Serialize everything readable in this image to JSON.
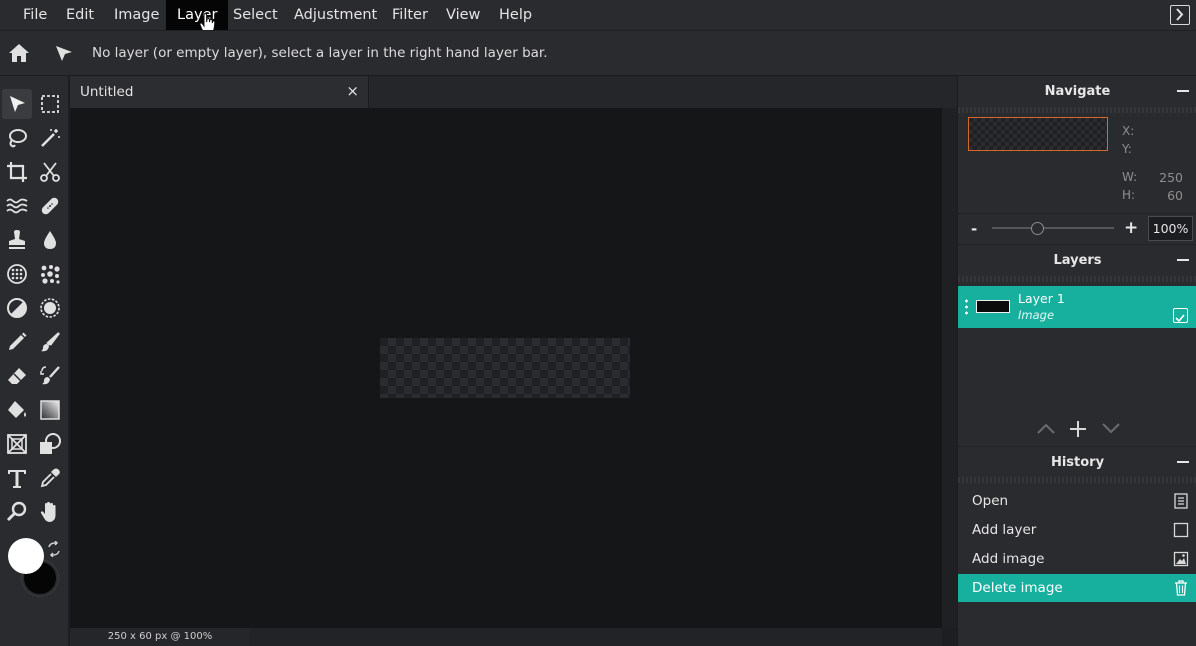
{
  "menubar": {
    "items": [
      {
        "label": "File"
      },
      {
        "label": "Edit"
      },
      {
        "label": "Image"
      },
      {
        "label": "Layer"
      },
      {
        "label": "Select"
      },
      {
        "label": "Adjustment"
      },
      {
        "label": "Filter"
      },
      {
        "label": "View"
      },
      {
        "label": "Help"
      }
    ],
    "active": "Layer"
  },
  "toolbar": {
    "status": "No layer (or empty layer), select a layer in the right hand layer bar."
  },
  "tools": [
    "pointer-icon",
    "marquee-select-icon",
    "lasso-icon",
    "magic-wand-icon",
    "crop-icon",
    "scissors-icon",
    "liquify-icon",
    "bandage-icon",
    "stamp-icon",
    "drop-icon",
    "sponge-icon",
    "blur-dots-icon",
    "dodge-icon",
    "burn-icon",
    "pencil-icon",
    "brush-icon",
    "eraser-icon",
    "color-replace-icon",
    "paint-bucket-icon",
    "gradient-icon",
    "frame-icon",
    "shape-icon",
    "text-icon",
    "eyedropper-icon",
    "zoom-icon",
    "hand-icon"
  ],
  "colors": {
    "foreground": "#ffffff",
    "background": "#000000",
    "accent": "#17b09f"
  },
  "document": {
    "tab_title": "Untitled",
    "close_glyph": "×",
    "footer_info": "250 x 60 px @ 100%"
  },
  "navigate": {
    "title": "Navigate",
    "x_label": "X:",
    "y_label": "Y:",
    "w_label": "W:",
    "w_value": "250",
    "h_label": "H:",
    "h_value": "60",
    "zoom_minus": "-",
    "zoom_plus": "+",
    "zoom_value": "100%"
  },
  "layers": {
    "title": "Layers",
    "items": [
      {
        "name": "Layer 1",
        "type": "Image",
        "visible": true
      }
    ]
  },
  "history": {
    "title": "History",
    "items": [
      {
        "label": "Open",
        "icon": "document-icon"
      },
      {
        "label": "Add layer",
        "icon": "square-icon"
      },
      {
        "label": "Add image",
        "icon": "image-icon"
      },
      {
        "label": "Delete image",
        "icon": "trash-icon"
      }
    ]
  }
}
